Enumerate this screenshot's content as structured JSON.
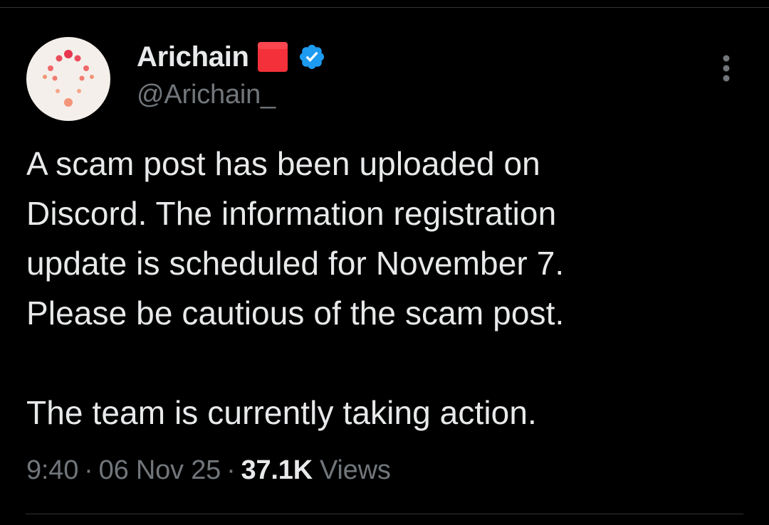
{
  "author": {
    "display_name": "Arichain",
    "handle": "@Arichain_",
    "flag_emoji": "red-square-emoji",
    "verified": true,
    "avatar_icon": "arichain-logo-icon"
  },
  "tweet": {
    "lines": [
      "A scam post has been uploaded on",
      "Discord. The information registration",
      "update is scheduled for November 7.",
      "Please be cautious of the scam post.",
      "",
      "The team is currently taking action."
    ]
  },
  "meta": {
    "time": "9:40",
    "separator": "·",
    "date": "06 Nov 25",
    "views_count": "37.1K",
    "views_label": "Views"
  },
  "colors": {
    "background": "#000000",
    "text_primary": "#e7e9ea",
    "text_secondary": "#71767b",
    "verified_blue": "#1d9bf0",
    "flag_red": "#f4303a",
    "divider": "#2f3336",
    "avatar_bg": "#f4efea"
  },
  "icons": {
    "more": "more-vertical-icon",
    "verified": "verified-badge-icon"
  }
}
